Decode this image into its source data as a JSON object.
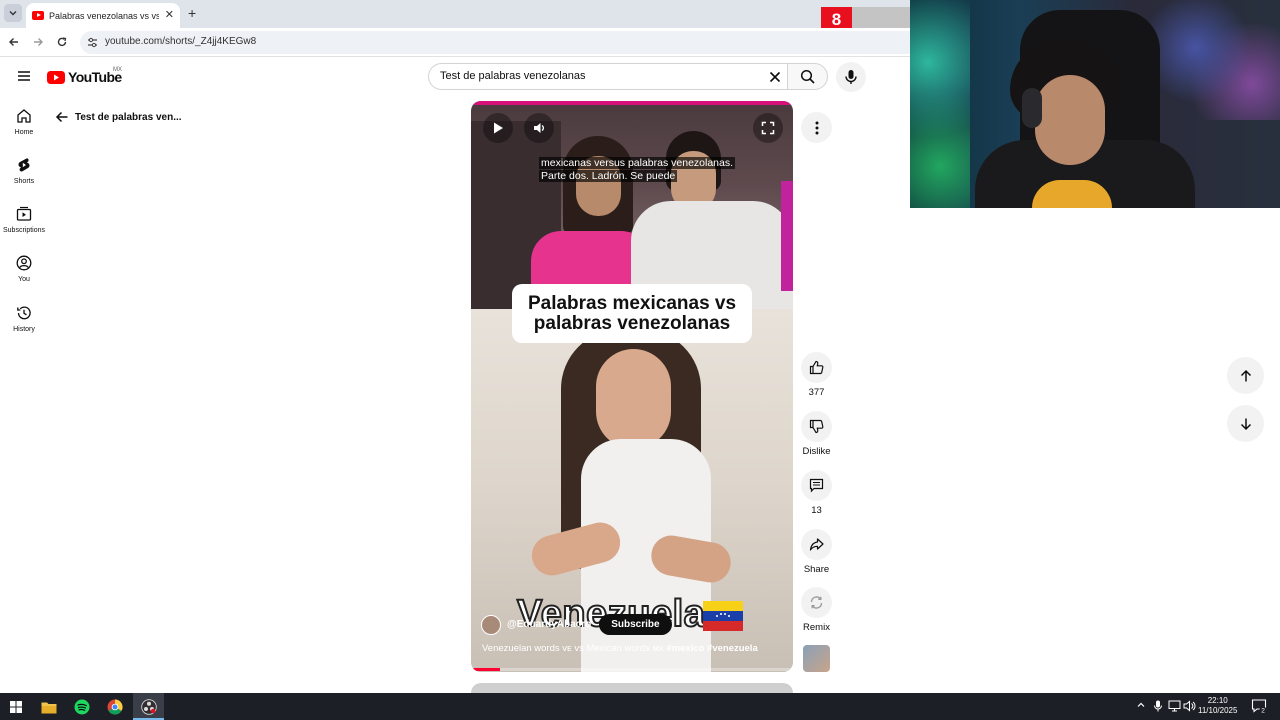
{
  "browser": {
    "tab_title": "Palabras venezolanas vs vs pala",
    "url": "youtube.com/shorts/_Z4jj4KEGw8"
  },
  "stream_overlay": {
    "counter": "8"
  },
  "youtube": {
    "country": "MX",
    "logo_text": "YouTube",
    "search_query": "Test de palabras venezolanas",
    "sidebar": [
      {
        "label": "Home"
      },
      {
        "label": "Shorts"
      },
      {
        "label": "Subscriptions"
      },
      {
        "label": "You"
      },
      {
        "label": "History"
      }
    ],
    "back_title": "Test de palabras ven..."
  },
  "video": {
    "caption_line1": "mexicanas versus palabras venezolanas.",
    "caption_line2": "Parte dos. Ladrón. Se puede",
    "title_card_line1": "Palabras mexicanas vs",
    "title_card_line2": "palabras venezolanas",
    "overlay_word": "Venezuela",
    "channel": "@EduardyAbacro",
    "subscribe_label": "Subscribe",
    "description": "Venezuelan words ᴠᴇ vs Mexican words ᴍx ",
    "hashtags": "#mexico #venezuela",
    "progress": 0.09
  },
  "actions": {
    "like_count": "377",
    "dislike_label": "Dislike",
    "comment_count": "13",
    "share_label": "Share",
    "remix_label": "Remix"
  },
  "taskbar": {
    "time": "22:10",
    "date": "11/10/2025",
    "notifications": "2"
  },
  "colors": {
    "youtube_red": "#ff0000",
    "stream_counter": "#e8101f",
    "taskbar": "#1c1f26"
  }
}
